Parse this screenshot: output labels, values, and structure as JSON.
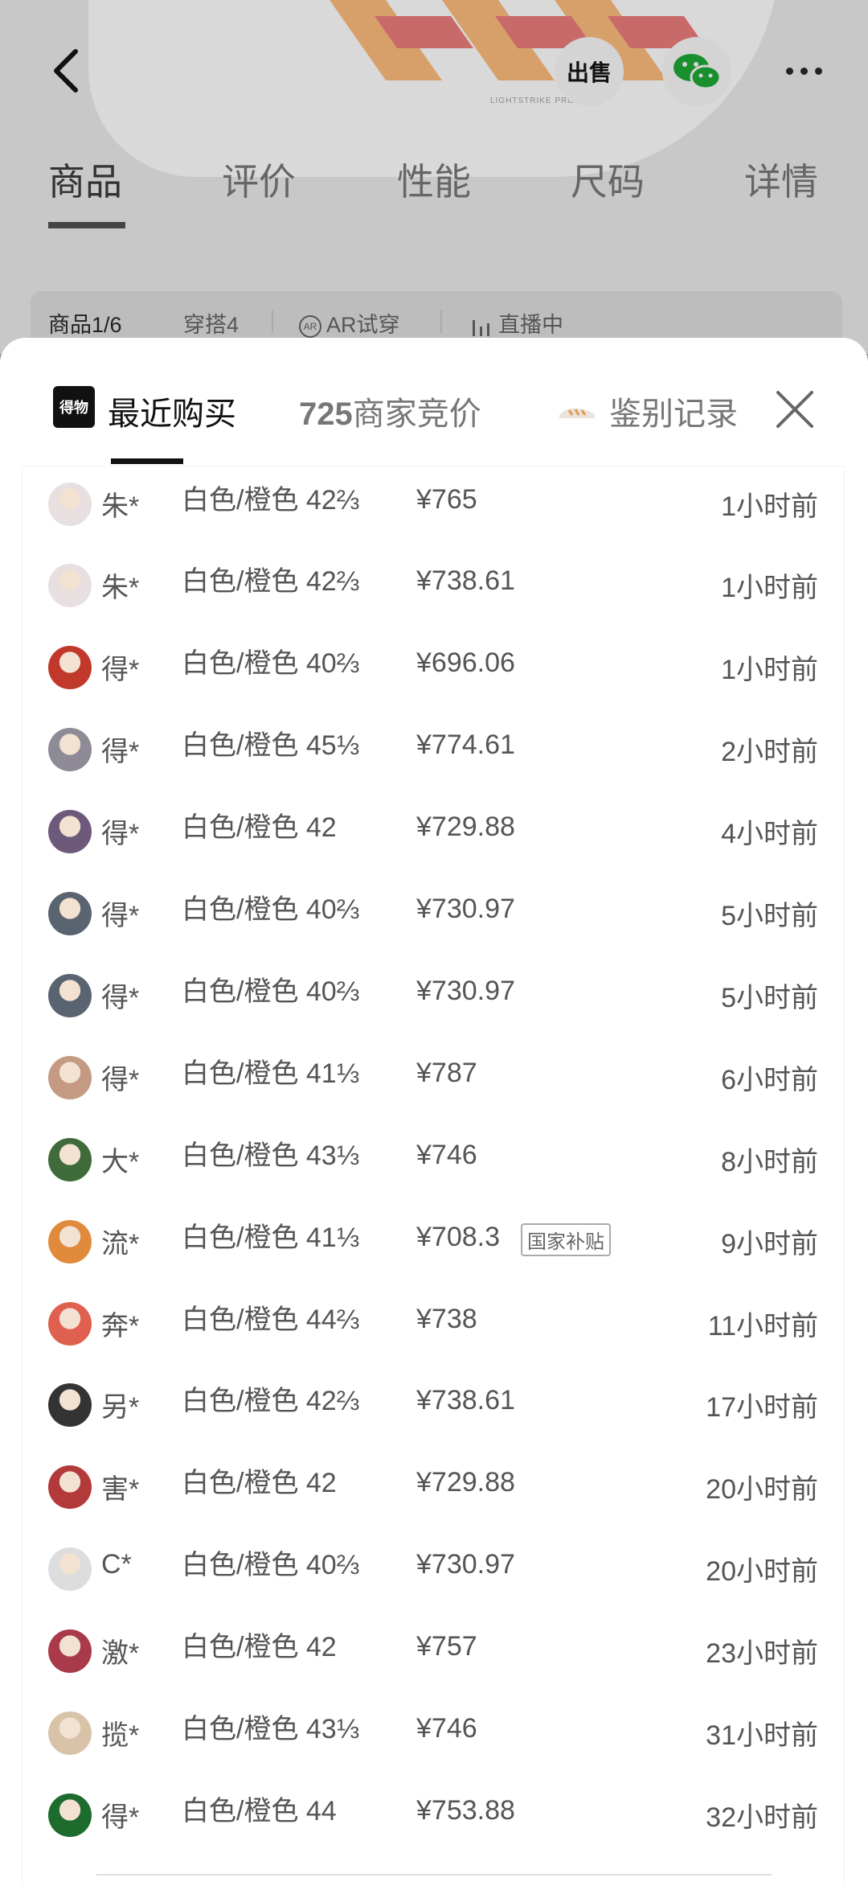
{
  "page_tabs": [
    "商品",
    "评价",
    "性能",
    "尺码",
    "详情"
  ],
  "sell_label": "出售",
  "shoe_text": "LIGHTSTRIKE PRO",
  "sub_tabs": [
    "商品1/6",
    "穿搭4",
    "AR试穿",
    "直播中"
  ],
  "sheet": {
    "logo": "得物",
    "tab_recent": "最近购买",
    "tab_bid_count": "725",
    "tab_bid_label": "商家竞价",
    "tab_auth": "鉴别记录"
  },
  "purchases": [
    {
      "name": "朱*",
      "spec": "白色/橙色 42⅔",
      "price": "¥765",
      "time": "1小时前",
      "avatar": "#e8e0e0"
    },
    {
      "name": "朱*",
      "spec": "白色/橙色 42⅔",
      "price": "¥738.61",
      "time": "1小时前",
      "avatar": "#e8e0e0"
    },
    {
      "name": "得*",
      "spec": "白色/橙色 40⅔",
      "price": "¥696.06",
      "time": "1小时前",
      "avatar": "#c0392b"
    },
    {
      "name": "得*",
      "spec": "白色/橙色 45⅓",
      "price": "¥774.61",
      "time": "2小时前",
      "avatar": "#8e8a96"
    },
    {
      "name": "得*",
      "spec": "白色/橙色 42",
      "price": "¥729.88",
      "time": "4小时前",
      "avatar": "#6d5a7a"
    },
    {
      "name": "得*",
      "spec": "白色/橙色 40⅔",
      "price": "¥730.97",
      "time": "5小时前",
      "avatar": "#5a6470"
    },
    {
      "name": "得*",
      "spec": "白色/橙色 40⅔",
      "price": "¥730.97",
      "time": "5小时前",
      "avatar": "#5a6470"
    },
    {
      "name": "得*",
      "spec": "白色/橙色 41⅓",
      "price": "¥787",
      "time": "6小时前",
      "avatar": "#c49a82"
    },
    {
      "name": "大*",
      "spec": "白色/橙色 43⅓",
      "price": "¥746",
      "time": "8小时前",
      "avatar": "#3f6b3a"
    },
    {
      "name": "流*",
      "spec": "白色/橙色 41⅓",
      "price": "¥708.3",
      "time": "9小时前",
      "avatar": "#e08a3c",
      "badge": "国家补贴"
    },
    {
      "name": "奔*",
      "spec": "白色/橙色 44⅔",
      "price": "¥738",
      "time": "11小时前",
      "avatar": "#e06050"
    },
    {
      "name": "另*",
      "spec": "白色/橙色 42⅔",
      "price": "¥738.61",
      "time": "17小时前",
      "avatar": "#333333"
    },
    {
      "name": "害*",
      "spec": "白色/橙色 42",
      "price": "¥729.88",
      "time": "20小时前",
      "avatar": "#b23a3a"
    },
    {
      "name": "C*",
      "spec": "白色/橙色 40⅔",
      "price": "¥730.97",
      "time": "20小时前",
      "avatar": "#dddddd"
    },
    {
      "name": "激*",
      "spec": "白色/橙色 42",
      "price": "¥757",
      "time": "23小时前",
      "avatar": "#a83a4a"
    },
    {
      "name": "揽*",
      "spec": "白色/橙色 43⅓",
      "price": "¥746",
      "time": "31小时前",
      "avatar": "#d9c3a8"
    },
    {
      "name": "得*",
      "spec": "白色/橙色 44",
      "price": "¥753.88",
      "time": "32小时前",
      "avatar": "#1e6b2e"
    }
  ]
}
